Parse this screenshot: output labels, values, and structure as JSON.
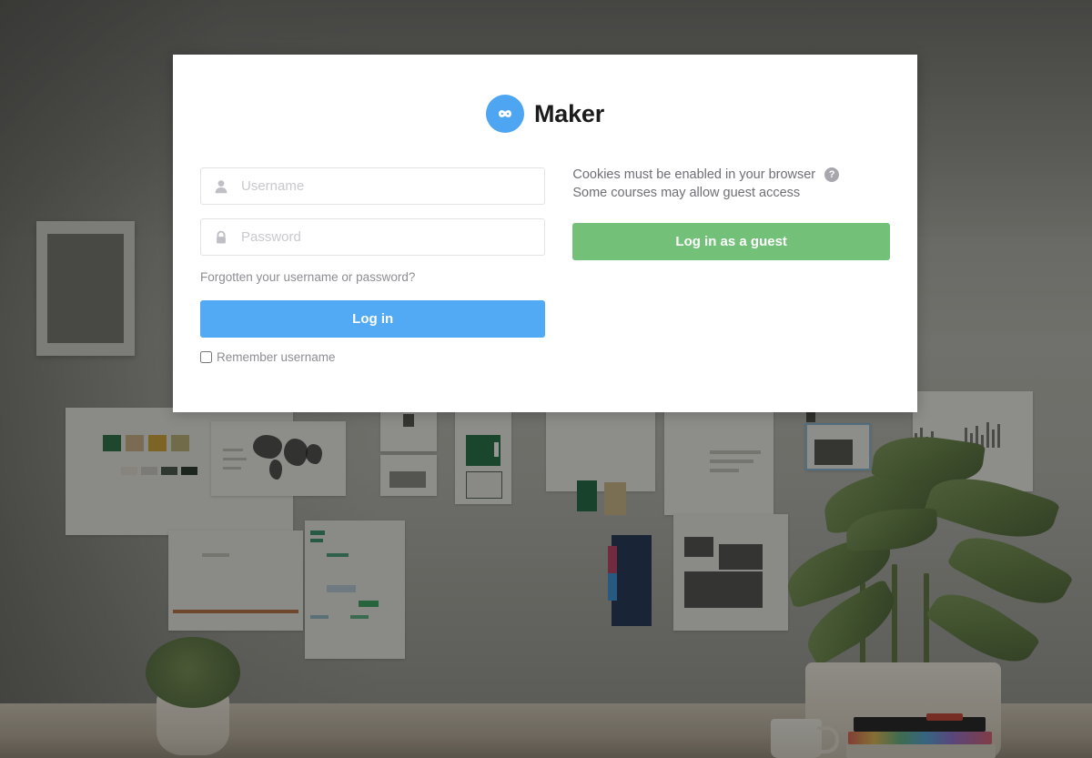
{
  "brand": {
    "name": "Maker",
    "logo_icon": "infinity-icon",
    "logo_color": "#4ea5f2",
    "name_color": "#1b1b1b"
  },
  "login_form": {
    "username": {
      "icon": "user-icon",
      "placeholder": "Username",
      "value": ""
    },
    "password": {
      "icon": "lock-icon",
      "placeholder": "Password",
      "value": ""
    },
    "forgot_link": "Forgotten your username or password?",
    "login_button": "Log in",
    "login_button_color": "#52aaf4",
    "remember_label": "Remember username",
    "remember_checked": false
  },
  "guest_panel": {
    "cookies_notice": "Cookies must be enabled in your browser",
    "help_icon": "help-circle-icon",
    "help_glyph": "?",
    "guest_notice": "Some courses may allow guest access",
    "guest_button": "Log in as a guest",
    "guest_button_color": "#73c178"
  },
  "background": {
    "description": "office-photo",
    "overlay_color": "rgba(32,32,30,0.47)"
  }
}
